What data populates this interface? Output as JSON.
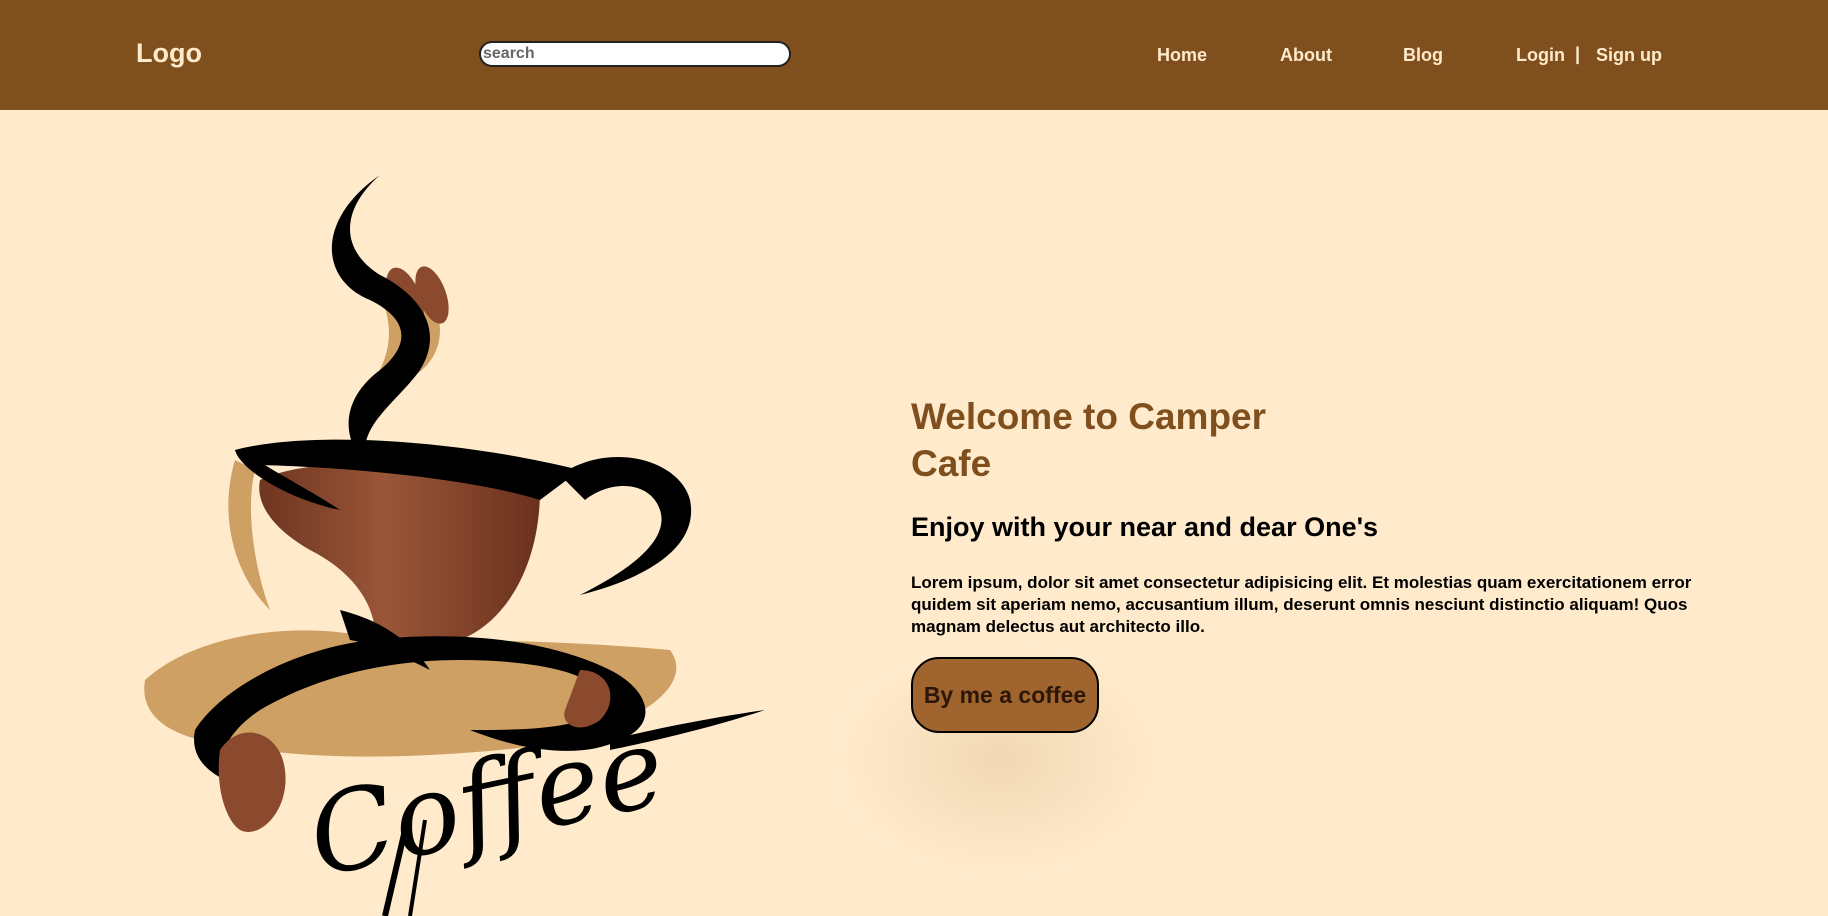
{
  "header": {
    "logo": "Logo",
    "search": {
      "placeholder": "search",
      "value": ""
    },
    "nav": {
      "home": "Home",
      "about": "About",
      "blog": "Blog",
      "login": "Login",
      "separator": "|",
      "signup": "Sign up"
    }
  },
  "hero": {
    "image_text": "Coffee",
    "title": "Welcome to Camper Cafe",
    "subtitle": "Enjoy with your near and dear One's",
    "body": "Lorem ipsum, dolor sit amet consectetur adipisicing elit. Et molestias quam exercitationem error quidem sit aperiam nemo, accusantium illum, deserunt omnis nesciunt distinctio aliquam! Quos magnam delectus aut architecto illo.",
    "button_label": "By me a coffee"
  },
  "colors": {
    "header_bg": "#7F4F1E",
    "page_bg": "#FFEBCC",
    "accent": "#7F4F1E",
    "button_bg": "#A0642F",
    "cup_brown": "#8B4A2E",
    "saucer_tan": "#CFA064"
  }
}
